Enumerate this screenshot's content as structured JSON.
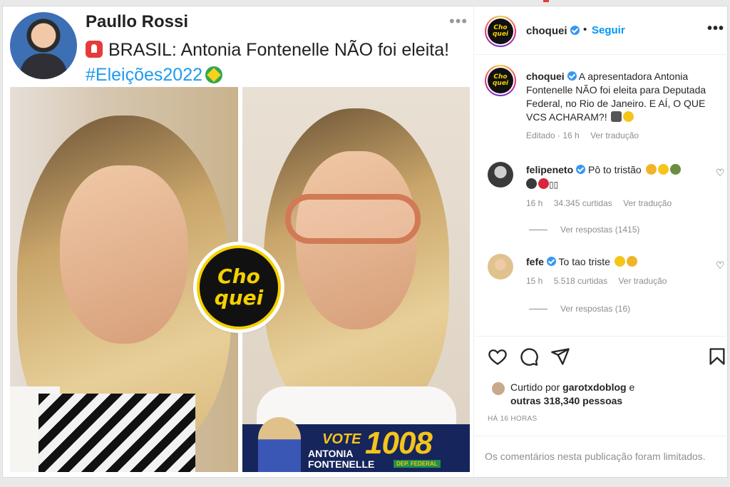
{
  "tweet": {
    "author": "Paullo Rossi",
    "text_main": "BRASIL: Antonia Fontenelle NÃO foi eleita!",
    "hashtag": "#Eleições2022"
  },
  "badge": {
    "line1": "Cho",
    "line2": "quei"
  },
  "vote_banner": {
    "label": "VOTE",
    "number": "1008",
    "name_line1": "ANTONIA",
    "name_line2": "FONTENELLE",
    "sub": "DEP. FEDERAL"
  },
  "header": {
    "username": "choquei",
    "separator": "•",
    "follow_label": "Seguir",
    "more_label": "•••",
    "logo_line1": "Cho",
    "logo_line2": "quei"
  },
  "caption": {
    "username": "choquei",
    "text": "A apresentadora Antonia Fontenelle NÃO foi eleita para Deputada Federal, no Rio de Janeiro. E AÍ, O QUE VCS ACHARAM?!",
    "edited": "Editado · 16 h",
    "translate": "Ver tradução"
  },
  "comments": [
    {
      "username": "felipeneto",
      "text": "Pô to tristão",
      "time": "16 h",
      "likes": "34.345 curtidas",
      "translate": "Ver tradução",
      "replies": "Ver respostas (1415)"
    },
    {
      "username": "fefe",
      "text": "To tao triste",
      "time": "15 h",
      "likes": "5.518 curtidas",
      "translate": "Ver tradução",
      "replies": "Ver respostas (16)"
    }
  ],
  "likes": {
    "prefix": "Curtido por",
    "user": "garotxdoblog",
    "suffix": "e",
    "others": "outras 318,340 pessoas"
  },
  "post_time": "HÁ 16 HORAS",
  "comments_limited": "Os comentários nesta publicação foram limitados.",
  "colors": {
    "follow_blue": "#0095f6",
    "verified_blue": "#3897f0",
    "hashtag_blue": "#1d9bf0",
    "choquei_yellow": "#f5d000"
  },
  "icons": [
    "heart-icon",
    "comment-icon",
    "share-icon",
    "bookmark-icon",
    "verified-icon",
    "more-icon"
  ]
}
